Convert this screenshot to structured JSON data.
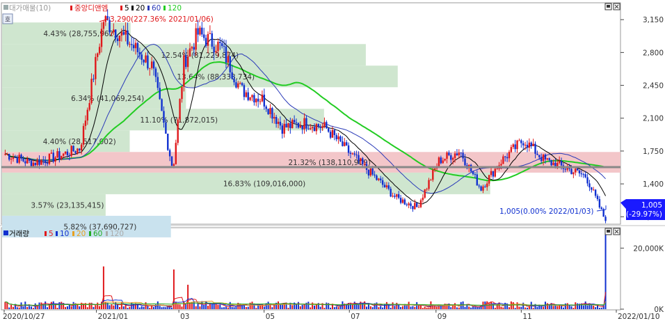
{
  "price_legend": {
    "mode_icon": "qty-toggle-icon",
    "mode_label": "대가매물(10)",
    "stock_name": "중앙디앤엠",
    "ma5": "5",
    "ma20": "20",
    "ma60": "60",
    "ma120": "120"
  },
  "volume_legend": {
    "title": "거래량",
    "ma5": "5",
    "ma10": "10",
    "ma20": "20",
    "ma60": "60",
    "ma120": "120"
  },
  "annotations": {
    "high": "3,290(227.36% 2021/01/06)",
    "low": "1,005(0.00% 2022/01/03)",
    "current_price": "1,005",
    "current_change": "(-29.97%)"
  },
  "price_axis": [
    "3,150",
    "2,800",
    "2,450",
    "2,100",
    "1,750",
    "1,400",
    "1,050"
  ],
  "volume_axis": [
    "20,000K",
    "0K"
  ],
  "date_axis": [
    "2020/10/27",
    "2021/01",
    "03",
    "05",
    "07",
    "09",
    "11",
    "2022/01/10"
  ],
  "colors": {
    "up": "#e0181b",
    "down": "#1030d0",
    "ma5": "#000000",
    "ma20": "#2a3ab8",
    "ma60": "#22cc22",
    "volume_profile_green": "#cfe6cf",
    "volume_profile_red": "#f3c6c9",
    "volume_profile_blue": "#c9e2ee",
    "current_price_bg": "#1a1aff"
  },
  "chart_data": {
    "type": "candlestick",
    "title": "중앙디앤엠",
    "period": [
      "2020/10/27",
      "2022/01/10"
    ],
    "ylim": [
      1000,
      3300
    ],
    "price_anchors": [
      {
        "date": "2020/10/27",
        "close": 1720
      },
      {
        "date": "2020/11/15",
        "close": 1620
      },
      {
        "date": "2020/12/05",
        "close": 1700
      },
      {
        "date": "2020/12/20",
        "close": 1780
      },
      {
        "date": "2021/01/06",
        "close": 3150
      },
      {
        "date": "2021/01/25",
        "close": 2900
      },
      {
        "date": "2021/02/10",
        "close": 2650
      },
      {
        "date": "2021/02/25",
        "close": 1550
      },
      {
        "date": "2021/03/05",
        "close": 2700
      },
      {
        "date": "2021/03/15",
        "close": 3000
      },
      {
        "date": "2021/04/01",
        "close": 2850
      },
      {
        "date": "2021/04/15",
        "close": 2400
      },
      {
        "date": "2021/05/01",
        "close": 2300
      },
      {
        "date": "2021/05/15",
        "close": 2000
      },
      {
        "date": "2021/06/01",
        "close": 2050
      },
      {
        "date": "2021/06/15",
        "close": 2000
      },
      {
        "date": "2021/07/01",
        "close": 1750
      },
      {
        "date": "2021/07/20",
        "close": 1480
      },
      {
        "date": "2021/08/05",
        "close": 1250
      },
      {
        "date": "2021/08/20",
        "close": 1150
      },
      {
        "date": "2021/09/05",
        "close": 1650
      },
      {
        "date": "2021/09/20",
        "close": 1750
      },
      {
        "date": "2021/10/05",
        "close": 1350
      },
      {
        "date": "2021/10/20",
        "close": 1650
      },
      {
        "date": "2021/11/05",
        "close": 1870
      },
      {
        "date": "2021/11/20",
        "close": 1650
      },
      {
        "date": "2021/12/05",
        "close": 1570
      },
      {
        "date": "2021/12/20",
        "close": 1480
      },
      {
        "date": "2022/01/03",
        "close": 1005
      }
    ],
    "high": {
      "value": 3290,
      "pct": "227.36%",
      "date": "2021/01/06"
    },
    "low": {
      "value": 1005,
      "pct": "0.00%",
      "date": "2022/01/03"
    },
    "volume_profile": [
      {
        "label": "4.43% (28,755,962)",
        "price_low": 2890,
        "price_high": 3120,
        "share": 4.43,
        "color": "green"
      },
      {
        "label": "12.54% (81,229,874)",
        "price_low": 2660,
        "price_high": 2890,
        "share": 12.54,
        "color": "green"
      },
      {
        "label": "13.64% (88,338,734)",
        "price_low": 2430,
        "price_high": 2660,
        "share": 13.64,
        "color": "green"
      },
      {
        "label": "6.34% (41,069,254)",
        "price_low": 2200,
        "price_high": 2430,
        "share": 6.34,
        "color": "green"
      },
      {
        "label": "11.10% (71,872,015)",
        "price_low": 1970,
        "price_high": 2200,
        "share": 11.1,
        "color": "green"
      },
      {
        "label": "4.40% (28,517,002)",
        "price_low": 1740,
        "price_high": 1970,
        "share": 4.4,
        "color": "green"
      },
      {
        "label": "21.32% (138,110,909)",
        "price_low": 1520,
        "price_high": 1740,
        "share": 21.32,
        "color": "red"
      },
      {
        "label": "16.83% (109,016,000)",
        "price_low": 1290,
        "price_high": 1520,
        "share": 16.83,
        "color": "green"
      },
      {
        "label": "3.57% (23,135,415)",
        "price_low": 1060,
        "price_high": 1290,
        "share": 3.57,
        "color": "green"
      },
      {
        "label": "5.82% (37,690,727)",
        "price_low": 830,
        "price_high": 1060,
        "share": 5.82,
        "color": "blue"
      }
    ],
    "volume": {
      "ylim": [
        0,
        26000
      ],
      "unit": "K",
      "spikes": [
        {
          "date": "2021/01/06",
          "value": 14000
        },
        {
          "date": "2021/02/25",
          "value": 13000
        },
        {
          "date": "2021/03/08",
          "value": 8000
        },
        {
          "date": "2022/01/04",
          "value": 24500
        }
      ]
    }
  }
}
